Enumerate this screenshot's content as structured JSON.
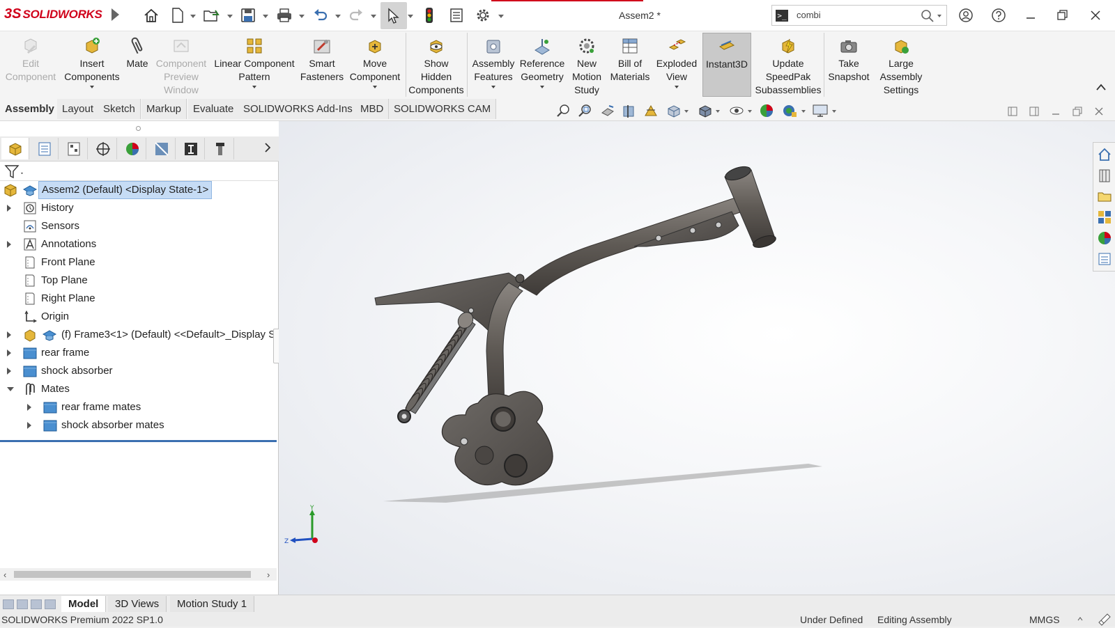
{
  "app": {
    "brand_mark": "3S",
    "brand_name": "SOLIDWORKS",
    "document_title": "Assem2 *"
  },
  "search": {
    "prompt_symbol": ">_",
    "value": "combi"
  },
  "command_manager": {
    "commands": [
      {
        "id": "edit-component",
        "label": "Edit\nComponent",
        "enabled": false,
        "dropdown": false
      },
      {
        "id": "insert-components",
        "label": "Insert\nComponents",
        "enabled": true,
        "dropdown": true
      },
      {
        "id": "mate",
        "label": "Mate",
        "enabled": true,
        "dropdown": false
      },
      {
        "id": "component-preview-window",
        "label": "Component\nPreview\nWindow",
        "enabled": false,
        "dropdown": false
      },
      {
        "id": "linear-component-pattern",
        "label": "Linear Component\nPattern",
        "enabled": true,
        "dropdown": true
      },
      {
        "id": "smart-fasteners",
        "label": "Smart\nFasteners",
        "enabled": true,
        "dropdown": false
      },
      {
        "id": "move-component",
        "label": "Move\nComponent",
        "enabled": true,
        "dropdown": true
      },
      {
        "id": "show-hidden-components",
        "label": "Show\nHidden\nComponents",
        "enabled": true,
        "dropdown": false
      },
      {
        "id": "assembly-features",
        "label": "Assembly\nFeatures",
        "enabled": true,
        "dropdown": true
      },
      {
        "id": "reference-geometry",
        "label": "Reference\nGeometry",
        "enabled": true,
        "dropdown": true
      },
      {
        "id": "new-motion-study",
        "label": "New\nMotion\nStudy",
        "enabled": true,
        "dropdown": false
      },
      {
        "id": "bill-of-materials",
        "label": "Bill of\nMaterials",
        "enabled": true,
        "dropdown": false
      },
      {
        "id": "exploded-view",
        "label": "Exploded\nView",
        "enabled": true,
        "dropdown": true
      },
      {
        "id": "instant3d",
        "label": "Instant3D",
        "enabled": true,
        "dropdown": false,
        "active": true
      },
      {
        "id": "update-speedpak",
        "label": "Update\nSpeedPak\nSubassemblies",
        "enabled": true,
        "dropdown": false
      },
      {
        "id": "take-snapshot",
        "label": "Take\nSnapshot",
        "enabled": true,
        "dropdown": false
      },
      {
        "id": "large-assembly-settings",
        "label": "Large\nAssembly\nSettings",
        "enabled": true,
        "dropdown": false
      }
    ]
  },
  "tabs": [
    {
      "label": "Assembly",
      "active": true
    },
    {
      "label": "Layout"
    },
    {
      "label": "Sketch"
    },
    {
      "label": "Markup"
    },
    {
      "label": "Evaluate"
    },
    {
      "label": "SOLIDWORKS Add-Ins"
    },
    {
      "label": "MBD"
    },
    {
      "label": "SOLIDWORKS CAM"
    }
  ],
  "feature_tree": {
    "root": "Assem2  (Default) <Display State-1>",
    "items": [
      {
        "label": "History",
        "icon": "history-icon",
        "expand": "closed",
        "level": 0
      },
      {
        "label": "Sensors",
        "icon": "sensors-icon",
        "expand": "none",
        "level": 0
      },
      {
        "label": "Annotations",
        "icon": "annotations-icon",
        "expand": "closed",
        "level": 0
      },
      {
        "label": "Front Plane",
        "icon": "plane-icon",
        "expand": "none",
        "level": 0
      },
      {
        "label": "Top Plane",
        "icon": "plane-icon",
        "expand": "none",
        "level": 0
      },
      {
        "label": "Right Plane",
        "icon": "plane-icon",
        "expand": "none",
        "level": 0
      },
      {
        "label": "Origin",
        "icon": "origin-icon",
        "expand": "none",
        "level": 0
      },
      {
        "label": "(f) Frame3<1> (Default) <<Default>_Display St",
        "icon": "part-icon",
        "expand": "closed",
        "level": 0
      },
      {
        "label": "rear frame",
        "icon": "folder-icon",
        "expand": "closed",
        "level": 0
      },
      {
        "label": "shock absorber",
        "icon": "folder-icon",
        "expand": "closed",
        "level": 0
      },
      {
        "label": "Mates",
        "icon": "mates-icon",
        "expand": "open",
        "level": 0
      },
      {
        "label": "rear frame mates",
        "icon": "folder-icon",
        "expand": "closed",
        "level": 1
      },
      {
        "label": "shock absorber mates",
        "icon": "folder-icon",
        "expand": "closed",
        "level": 1
      }
    ]
  },
  "bottom_tabs": [
    {
      "label": "Model",
      "active": true
    },
    {
      "label": "3D Views"
    },
    {
      "label": "Motion Study 1"
    }
  ],
  "status": {
    "product": "SOLIDWORKS Premium 2022 SP1.0",
    "definition": "Under Defined",
    "mode": "Editing Assembly",
    "units": "MMGS"
  },
  "triad": {
    "y": "Y",
    "z": "Z"
  },
  "colors": {
    "brand": "#d0021b",
    "selection": "#c6dcf5",
    "model_body": "#5a5652"
  }
}
